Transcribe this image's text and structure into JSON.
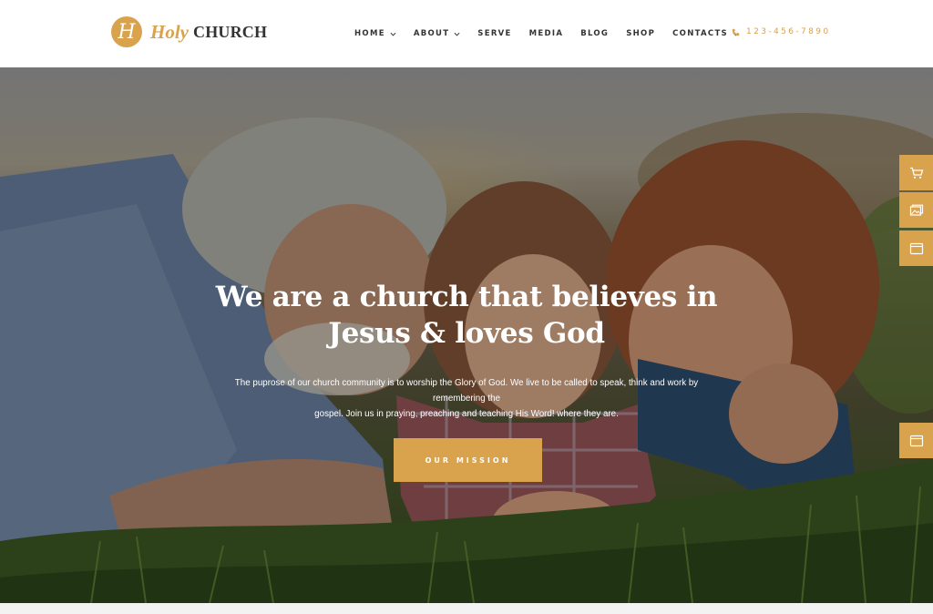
{
  "logo": {
    "mark": "H",
    "holy": "Holy",
    "church": "CHURCH"
  },
  "nav": [
    {
      "label": "HOME",
      "has_dropdown": true
    },
    {
      "label": "ABOUT",
      "has_dropdown": true
    },
    {
      "label": "SERVE",
      "has_dropdown": false
    },
    {
      "label": "MEDIA",
      "has_dropdown": false
    },
    {
      "label": "BLOG",
      "has_dropdown": false
    },
    {
      "label": "SHOP",
      "has_dropdown": false
    },
    {
      "label": "CONTACTS",
      "has_dropdown": true
    }
  ],
  "phone": {
    "icon": "phone-icon",
    "number": "123-456-7890"
  },
  "hero": {
    "title_line1": "We are a church that believes in",
    "title_line2": "Jesus & loves God",
    "description_line1": "The puprose of our church community is to worship the Glory of God. We live to be called to speak, think and work by remembering the",
    "description_line2": "gospel. Join us in praying, preaching and teaching His Word! where they are.",
    "cta_label": "OUR MISSION"
  },
  "side_buttons": [
    {
      "icon": "cart-icon"
    },
    {
      "icon": "gallery-icon"
    },
    {
      "icon": "browser-window-icon"
    },
    {
      "icon": "browser-window-icon"
    }
  ],
  "colors": {
    "accent": "#d9a24d",
    "text_dark": "#333333",
    "white": "#ffffff"
  }
}
